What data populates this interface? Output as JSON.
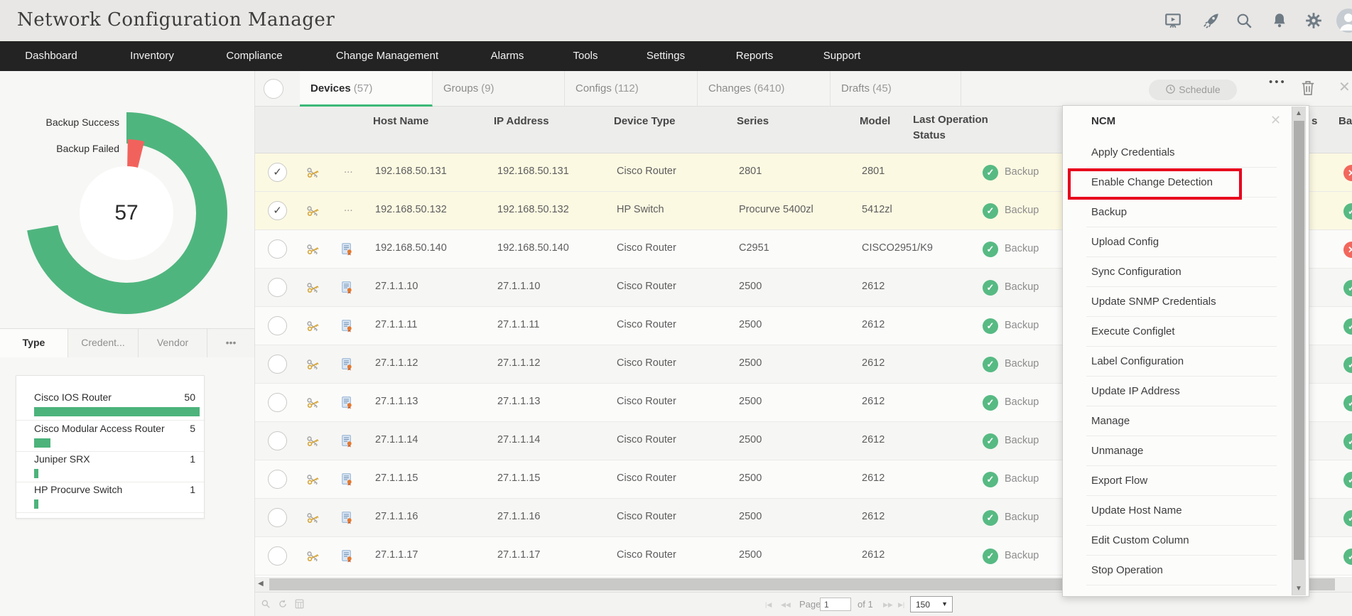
{
  "app": {
    "title": "Network Configuration Manager"
  },
  "topbar": {
    "icons": [
      "presentation-icon",
      "rocket-icon",
      "search-icon",
      "bell-icon",
      "gear-icon",
      "user-avatar"
    ]
  },
  "nav": {
    "items": [
      "Dashboard",
      "Inventory",
      "Compliance",
      "Change Management",
      "Alarms",
      "Tools",
      "Settings",
      "Reports",
      "Support"
    ]
  },
  "chart_data": {
    "type": "donut",
    "title": "Backup status donut",
    "center_value": "57",
    "segments": [
      {
        "label": "Backup Success",
        "color": "#4fb57e",
        "start_deg": -90,
        "sweep_deg": 260,
        "radius": 120,
        "thickness": 44
      },
      {
        "label": "Backup Failed",
        "color": "#f2625d",
        "start_deg": -89,
        "sweep_deg": 13,
        "radius": 85,
        "thickness": 38
      }
    ],
    "legend_position": "left",
    "grid": false
  },
  "sidebar": {
    "tabs": [
      {
        "label": "Type",
        "active": true
      },
      {
        "label": "Credent...",
        "active": false
      },
      {
        "label": "Vendor",
        "active": false
      },
      {
        "label": "•••",
        "active": false
      }
    ],
    "type_list": {
      "max": 50,
      "items": [
        {
          "label": "Cisco IOS Router",
          "value": 50
        },
        {
          "label": "Cisco Modular Access Router",
          "value": 5
        },
        {
          "label": "Juniper SRX",
          "value": 1
        },
        {
          "label": "HP Procurve Switch",
          "value": 1
        }
      ]
    }
  },
  "main": {
    "tabs": [
      {
        "label": "Devices",
        "count": "(57)",
        "active": true
      },
      {
        "label": "Groups",
        "count": "(9)",
        "active": false
      },
      {
        "label": "Configs",
        "count": "(112)",
        "active": false
      },
      {
        "label": "Changes",
        "count": "(6410)",
        "active": false
      },
      {
        "label": "Drafts",
        "count": "(45)",
        "active": false
      }
    ],
    "toolbar": {
      "schedule_label": "Schedule",
      "more_label": "•••"
    },
    "table": {
      "columns": [
        "Host Name",
        "IP Address",
        "Device Type",
        "Series",
        "Model",
        "Last Operation Status"
      ],
      "edge_headers": [
        "s",
        "Ba"
      ],
      "rows": [
        {
          "checked": true,
          "more": "...",
          "cert": false,
          "host": "192.168.50.131",
          "ip": "192.168.50.131",
          "type": "Cisco Router",
          "series": "2801",
          "model": "2801",
          "status": "Backup",
          "edge": "fail",
          "selected": true
        },
        {
          "checked": true,
          "more": "...",
          "cert": false,
          "host": "192.168.50.132",
          "ip": "192.168.50.132",
          "type": "HP Switch",
          "series": "Procurve 5400zl",
          "model": "5412zl",
          "status": "Backup",
          "edge": "ok",
          "selected": true
        },
        {
          "checked": false,
          "more": "",
          "cert": true,
          "host": "192.168.50.140",
          "ip": "192.168.50.140",
          "type": "Cisco Router",
          "series": "C2951",
          "model": "CISCO2951/K9",
          "status": "Backup",
          "edge": "fail",
          "selected": false
        },
        {
          "checked": false,
          "more": "",
          "cert": true,
          "host": "27.1.1.10",
          "ip": "27.1.1.10",
          "type": "Cisco Router",
          "series": "2500",
          "model": "2612",
          "status": "Backup",
          "edge": "ok",
          "selected": false
        },
        {
          "checked": false,
          "more": "",
          "cert": true,
          "host": "27.1.1.11",
          "ip": "27.1.1.11",
          "type": "Cisco Router",
          "series": "2500",
          "model": "2612",
          "status": "Backup",
          "edge": "ok",
          "selected": false
        },
        {
          "checked": false,
          "more": "",
          "cert": true,
          "host": "27.1.1.12",
          "ip": "27.1.1.12",
          "type": "Cisco Router",
          "series": "2500",
          "model": "2612",
          "status": "Backup",
          "edge": "ok",
          "selected": false
        },
        {
          "checked": false,
          "more": "",
          "cert": true,
          "host": "27.1.1.13",
          "ip": "27.1.1.13",
          "type": "Cisco Router",
          "series": "2500",
          "model": "2612",
          "status": "Backup",
          "edge": "ok",
          "selected": false
        },
        {
          "checked": false,
          "more": "",
          "cert": true,
          "host": "27.1.1.14",
          "ip": "27.1.1.14",
          "type": "Cisco Router",
          "series": "2500",
          "model": "2612",
          "status": "Backup",
          "edge": "ok",
          "selected": false
        },
        {
          "checked": false,
          "more": "",
          "cert": true,
          "host": "27.1.1.15",
          "ip": "27.1.1.15",
          "type": "Cisco Router",
          "series": "2500",
          "model": "2612",
          "status": "Backup",
          "edge": "ok",
          "selected": false
        },
        {
          "checked": false,
          "more": "",
          "cert": true,
          "host": "27.1.1.16",
          "ip": "27.1.1.16",
          "type": "Cisco Router",
          "series": "2500",
          "model": "2612",
          "status": "Backup",
          "edge": "ok",
          "selected": false
        },
        {
          "checked": false,
          "more": "",
          "cert": true,
          "host": "27.1.1.17",
          "ip": "27.1.1.17",
          "type": "Cisco Router",
          "series": "2500",
          "model": "2612",
          "status": "Backup",
          "edge": "ok",
          "selected": false
        }
      ]
    },
    "pagination": {
      "first": "|◀",
      "prev": "◀◀",
      "page_label": "Page",
      "page_value": "1",
      "of_label": "of 1",
      "next": "▶▶",
      "last": "▶|",
      "page_size": "150",
      "size_arrow": "▼"
    },
    "menu": {
      "title": "NCM",
      "close": "✕",
      "highlighted_index": 1,
      "items": [
        "Apply Credentials",
        "Enable Change Detection",
        "Backup",
        "Upload Config",
        "Sync Configuration",
        "Update SNMP Credentials",
        "Execute Configlet",
        "Label Configuration",
        "Update IP Address",
        "Manage",
        "Unmanage",
        "Export Flow",
        "Update Host Name",
        "Edit Custom Column",
        "Stop Operation"
      ]
    }
  },
  "colors": {
    "accent_green": "#3cb878",
    "status_ok": "#57ba83",
    "status_fail": "#f2675c",
    "selected_row": "#fcf9e2",
    "highlight_red": "#e8001c",
    "navbar_bg": "#232323"
  }
}
